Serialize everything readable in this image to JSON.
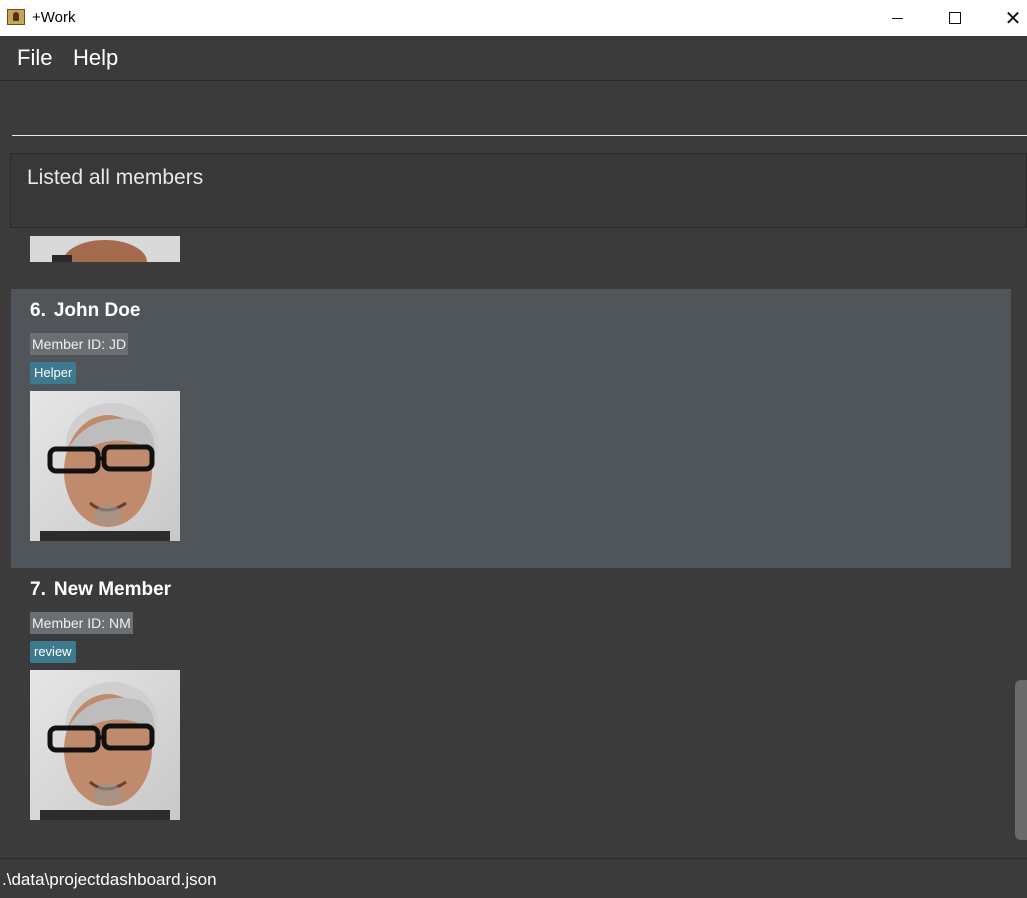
{
  "window": {
    "title": "+Work",
    "app_icon": "address-book-icon",
    "controls": {
      "minimize": "minimize-icon",
      "maximize": "maximize-icon",
      "close": "close-icon"
    }
  },
  "menu": {
    "items": [
      {
        "label": "File"
      },
      {
        "label": "Help"
      }
    ]
  },
  "command": {
    "value": "",
    "placeholder": ""
  },
  "result": {
    "message": "Listed all members"
  },
  "members": [
    {
      "index": "6.",
      "name": "John Doe",
      "member_id": "Member ID: JD",
      "tags": [
        "Helper"
      ],
      "selected": true
    },
    {
      "index": "7.",
      "name": "New Member",
      "member_id": "Member ID: NM",
      "tags": [
        "review"
      ],
      "selected": false
    }
  ],
  "status": {
    "file_path": ".\\data\\projectdashboard.json"
  },
  "colors": {
    "background": "#3b3b3c",
    "selected_card": "#4f5558",
    "tag": "#3d7a90",
    "member_id_bg": "#6b6f73"
  }
}
